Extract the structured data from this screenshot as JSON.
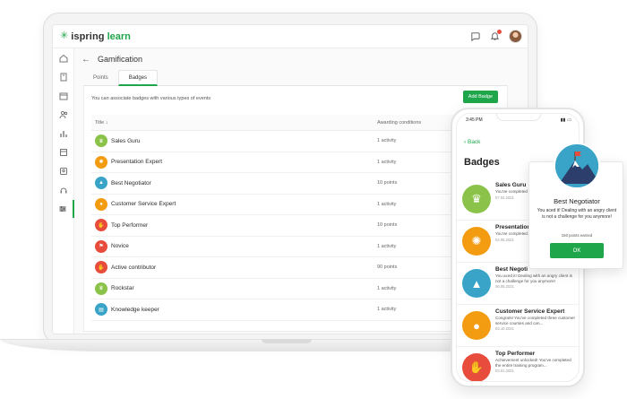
{
  "topbar": {
    "brand_name": "ispring",
    "brand_accent": "learn"
  },
  "sidenav": {
    "items": [
      "home-icon",
      "book-icon",
      "calendar-icon",
      "users-icon",
      "chart-icon",
      "catalog-icon",
      "id-card-icon",
      "headset-icon",
      "sliders-icon"
    ]
  },
  "page": {
    "title": "Gamification",
    "tabs": [
      {
        "label": "Points"
      },
      {
        "label": "Badges"
      }
    ],
    "description": "You can associate badges with various types of events",
    "add_badge_label": "Add Badge"
  },
  "table": {
    "headers": {
      "title": "Title ↓",
      "conditions": "Awarding conditions"
    },
    "rows": [
      {
        "title": "Sales Guru",
        "condition": "1 activity",
        "color": "#8bc34a",
        "icon": "trophy-icon"
      },
      {
        "title": "Presentation Expert",
        "condition": "1 activity",
        "color": "#f39c12",
        "icon": "lion-icon"
      },
      {
        "title": "Best Negotiator",
        "condition": "10 points",
        "color": "#3aa4c8",
        "icon": "mountain-icon"
      },
      {
        "title": "Customer Service Expert",
        "condition": "1 activity",
        "color": "#f39c12",
        "icon": "balloon-icon"
      },
      {
        "title": "Top Performer",
        "condition": "10 points",
        "color": "#e74c3c",
        "icon": "thumb-icon"
      },
      {
        "title": "Novice",
        "condition": "1 activity",
        "color": "#e74c3c",
        "icon": "flag-icon"
      },
      {
        "title": "Active contributor",
        "condition": "90 points",
        "color": "#e74c3c",
        "icon": "thumb-icon"
      },
      {
        "title": "Rockstar",
        "condition": "1 activity",
        "color": "#8bc34a",
        "icon": "trophy-icon"
      },
      {
        "title": "Knowledge keeper",
        "condition": "1 activity",
        "color": "#3aa4c8",
        "icon": "book-icon"
      }
    ]
  },
  "phone": {
    "time": "3:45 PM",
    "back_label": "Back",
    "title": "Badges",
    "items": [
      {
        "name": "Sales Guru",
        "desc": "You've completed \"... techniques\", and e...",
        "date": "07.04.2021",
        "color": "#8bc34a",
        "icon": "trophy-icon"
      },
      {
        "name": "Presentation",
        "desc": "You've completed... training program...",
        "date": "04.05.2021",
        "color": "#f39c12",
        "icon": "lion-icon"
      },
      {
        "name": "Best Negoti",
        "desc": "You aced it! Dealing with an angry client is not a challenge for you anymore!",
        "date": "06.05.2021",
        "color": "#3aa4c8",
        "icon": "mountain-icon"
      },
      {
        "name": "Customer Service Expert",
        "desc": "Congrats! You've completed three customer service courses and can...",
        "date": "03.10.2021",
        "color": "#f39c12",
        "icon": "balloon-icon"
      },
      {
        "name": "Top Performer",
        "desc": "Achievement unlocked! You've completed the entire training program...",
        "date": "03.01.2021",
        "color": "#e74c3c",
        "icon": "thumb-icon"
      }
    ]
  },
  "popup": {
    "title": "Best Negotiator",
    "message": "You aced it! Dealing with an angry client is not a challenge for you anymore!",
    "points": "150 points earned",
    "ok_label": "OK"
  }
}
